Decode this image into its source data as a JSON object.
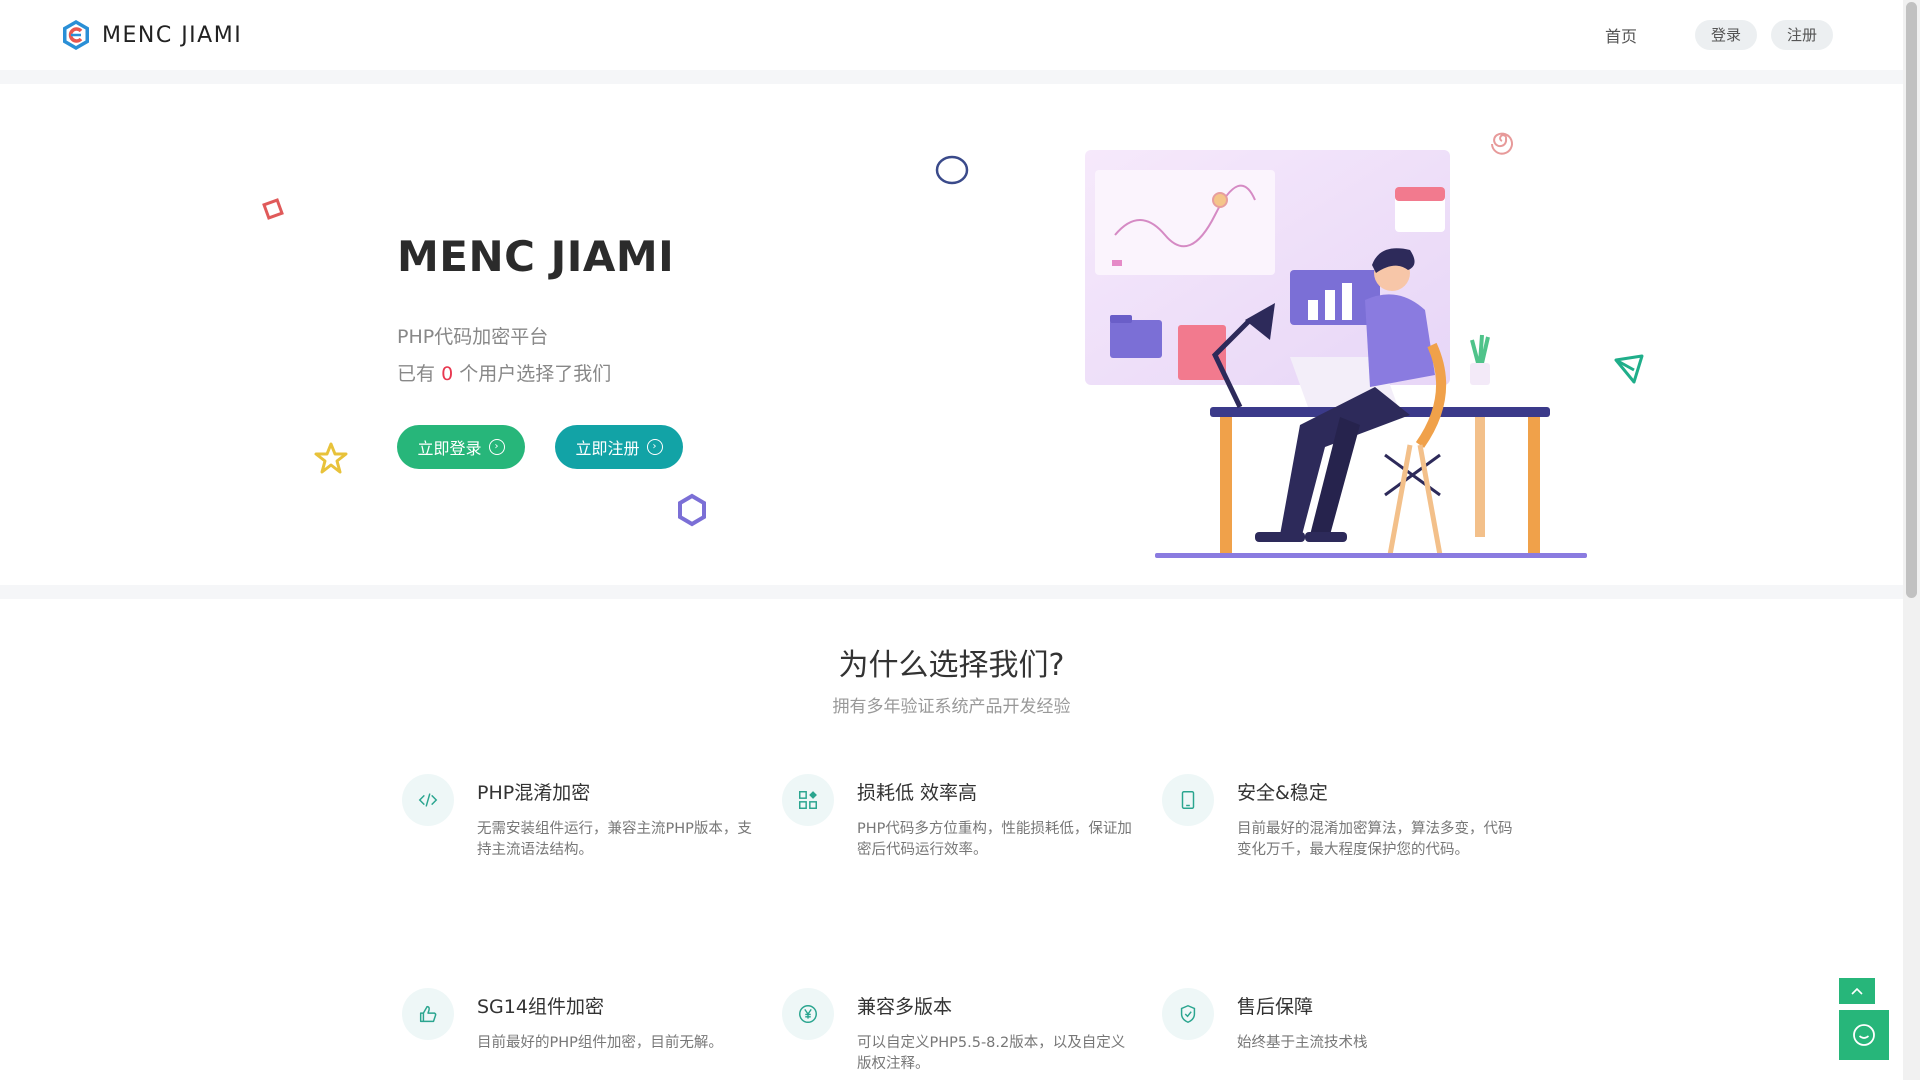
{
  "header": {
    "brand": "MENC JIAMI",
    "nav": {
      "home": "首页",
      "login": "登录",
      "register": "注册"
    }
  },
  "hero": {
    "title": "MENC JIAMI",
    "subtitle": "PHP代码加密平台",
    "users_prefix": "已有",
    "users_count": "0",
    "users_suffix": "个用户选择了我们",
    "login_button": "立即登录",
    "register_button": "立即注册"
  },
  "why": {
    "title": "为什么选择我们?",
    "subtitle": "拥有多年验证系统产品开发经验",
    "features": [
      {
        "icon": "code-icon",
        "title": "PHP混淆加密",
        "desc": "无需安装组件运行，兼容主流PHP版本，支持主流语法结构。"
      },
      {
        "icon": "apps-icon",
        "title": "损耗低 效率高",
        "desc": "PHP代码多方位重构，性能损耗低，保证加密后代码运行效率。"
      },
      {
        "icon": "tablet-icon",
        "title": "安全&稳定",
        "desc": "目前最好的混淆加密算法，算法多变，代码变化万千，最大程度保护您的代码。"
      },
      {
        "icon": "thumbs-up-icon",
        "title": "SG14组件加密",
        "desc": "目前最好的PHP组件加密，目前无解。"
      },
      {
        "icon": "yen-icon",
        "title": "兼容多版本",
        "desc": "可以自定义PHP5.5-8.2版本，以及自定义版权注释。"
      },
      {
        "icon": "shield-check-icon",
        "title": "售后保障",
        "desc": "始终基于主流技术栈"
      }
    ]
  },
  "colors": {
    "green": "#27b67a",
    "teal": "#12a3a6",
    "accent_red": "#e8374f",
    "purple": "#7b6fd6"
  }
}
